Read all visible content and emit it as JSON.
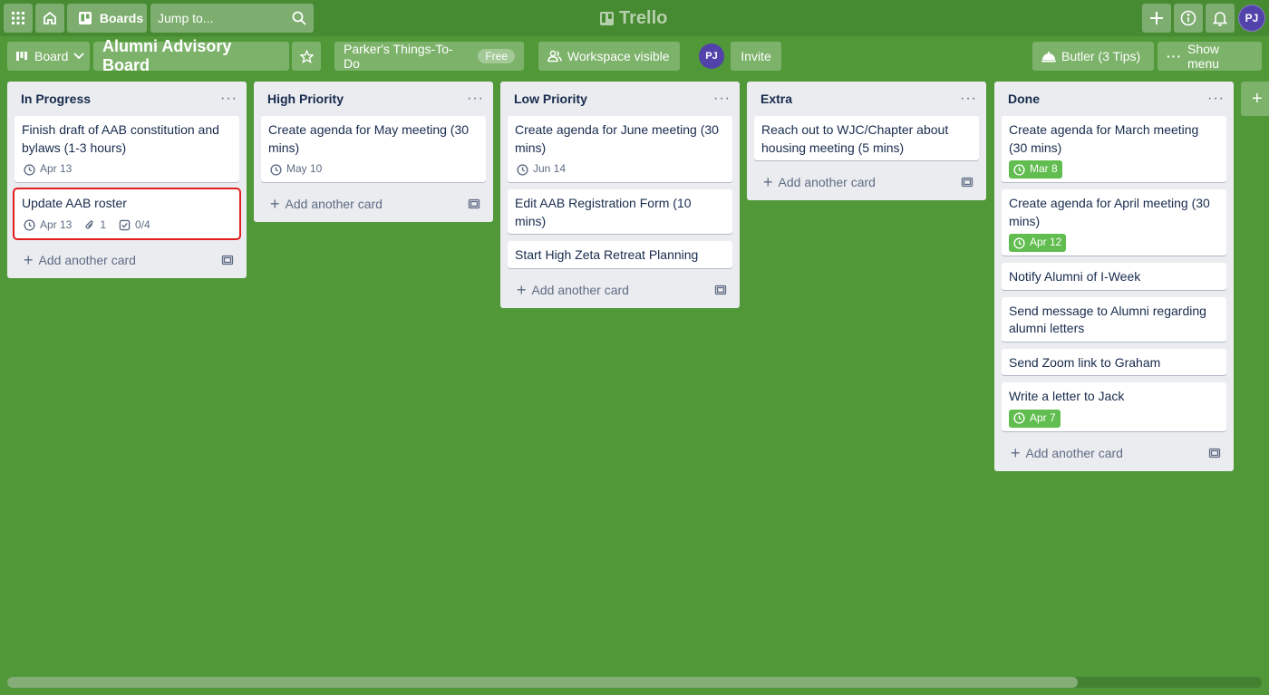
{
  "header": {
    "boards_label": "Boards",
    "search_placeholder": "Jump to...",
    "logo_text": "Trello",
    "avatar_initials": "PJ"
  },
  "board": {
    "view_label": "Board",
    "title": "Alumni Advisory Board",
    "workspace_label": "Parker's Things-To-Do",
    "workspace_badge": "Free",
    "visibility_label": "Workspace visible",
    "member_initials": "PJ",
    "invite_label": "Invite",
    "butler_label": "Butler (3 Tips)",
    "menu_label": "Show menu"
  },
  "add_card_label": "Add another card",
  "lists": [
    {
      "title": "In Progress",
      "cards": [
        {
          "title": "Finish draft of AAB constitution and bylaws (1-3 hours)",
          "due": "Apr 13"
        },
        {
          "title": "Update AAB roster",
          "due": "Apr 13",
          "attachments": "1",
          "checklist": "0/4"
        }
      ]
    },
    {
      "title": "High Priority",
      "cards": [
        {
          "title": "Create agenda for May meeting (30 mins)",
          "due": "May 10"
        }
      ]
    },
    {
      "title": "Low Priority",
      "cards": [
        {
          "title": "Create agenda for June meeting (30 mins)",
          "due": "Jun 14"
        },
        {
          "title": "Edit AAB Registration Form (10 mins)"
        },
        {
          "title": "Start High Zeta Retreat Planning"
        }
      ]
    },
    {
      "title": "Extra",
      "cards": [
        {
          "title": "Reach out to WJC/Chapter about housing meeting (5 mins)"
        }
      ]
    },
    {
      "title": "Done",
      "cards": [
        {
          "title": "Create agenda for March meeting (30 mins)",
          "due": "Mar 8"
        },
        {
          "title": "Create agenda for April meeting (30 mins)",
          "due": "Apr 12"
        },
        {
          "title": "Notify Alumni of I-Week"
        },
        {
          "title": "Send message to Alumni regarding alumni letters"
        },
        {
          "title": "Send Zoom link to Graham"
        },
        {
          "title": "Write a letter to Jack",
          "due": "Apr 7"
        }
      ]
    }
  ],
  "colors": {
    "board_bg": "#519839",
    "header_bg": "#468a31",
    "list_bg": "#ebecf0",
    "due_complete": "#61bd4f",
    "selection_outline": "#e01e1e"
  }
}
